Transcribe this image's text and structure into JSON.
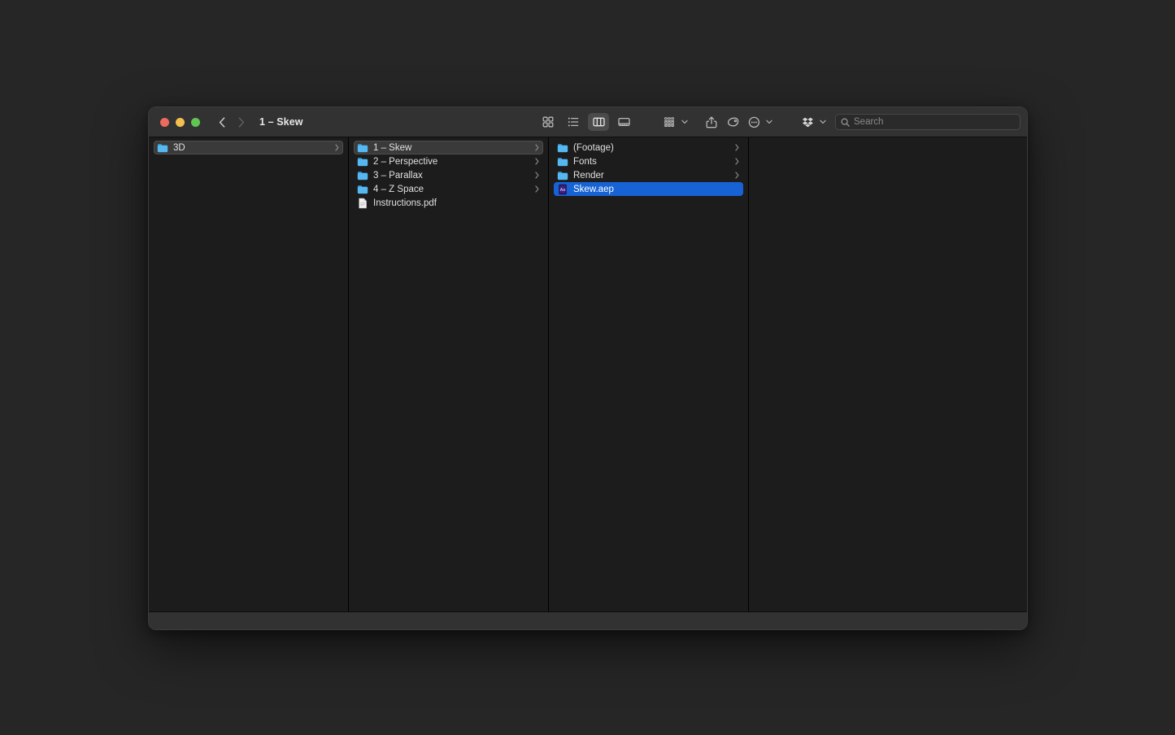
{
  "window": {
    "title": "1 – Skew",
    "traffic_lights": [
      {
        "name": "close",
        "color": "#ed6a5e"
      },
      {
        "name": "minimize",
        "color": "#f4bf4f"
      },
      {
        "name": "maximize",
        "color": "#61c554"
      }
    ]
  },
  "toolbar": {
    "back_icon": "chevron-left-icon",
    "forward_icon": "chevron-right-icon",
    "view_modes": [
      {
        "id": "icon",
        "icon": "grid-view-icon",
        "label": "Icon View",
        "active": false
      },
      {
        "id": "list",
        "icon": "list-view-icon",
        "label": "List View",
        "active": false
      },
      {
        "id": "column",
        "icon": "column-view-icon",
        "label": "Column View",
        "active": true
      },
      {
        "id": "gallery",
        "icon": "gallery-view-icon",
        "label": "Gallery View",
        "active": false
      }
    ],
    "group_by": {
      "icon": "group-by-icon",
      "label": "Group Items"
    },
    "share": {
      "icon": "share-icon",
      "label": "Share"
    },
    "tags": {
      "icon": "tag-icon",
      "label": "Edit Tags"
    },
    "action": {
      "icon": "action-menu-icon",
      "label": "Action Menu"
    },
    "dropbox": {
      "icon": "dropbox-icon",
      "label": "Dropbox"
    }
  },
  "search": {
    "icon": "search-icon",
    "placeholder": "Search",
    "value": ""
  },
  "columns": [
    {
      "id": "column-1",
      "items": [
        {
          "name": "3D",
          "kind": "folder",
          "icon": "folder-icon",
          "selected": "inactive",
          "disclosure": true
        }
      ]
    },
    {
      "id": "column-2",
      "items": [
        {
          "name": "1 – Skew",
          "kind": "folder",
          "icon": "folder-icon",
          "selected": "inactive",
          "disclosure": true
        },
        {
          "name": "2 – Perspective",
          "kind": "folder",
          "icon": "folder-icon",
          "selected": "none",
          "disclosure": true
        },
        {
          "name": "3 – Parallax",
          "kind": "folder",
          "icon": "folder-icon",
          "selected": "none",
          "disclosure": true
        },
        {
          "name": "4 – Z Space",
          "kind": "folder",
          "icon": "folder-icon",
          "selected": "none",
          "disclosure": true
        },
        {
          "name": "Instructions.pdf",
          "kind": "file",
          "icon": "pdf-document-icon",
          "selected": "none",
          "disclosure": false
        }
      ]
    },
    {
      "id": "column-3",
      "items": [
        {
          "name": "(Footage)",
          "kind": "folder",
          "icon": "folder-icon",
          "selected": "none",
          "disclosure": true
        },
        {
          "name": "Fonts",
          "kind": "folder",
          "icon": "folder-icon",
          "selected": "none",
          "disclosure": true
        },
        {
          "name": "Render",
          "kind": "folder",
          "icon": "folder-icon",
          "selected": "none",
          "disclosure": true
        },
        {
          "name": "Skew.aep",
          "kind": "file",
          "icon": "after-effects-project-icon",
          "selected": "active",
          "disclosure": false
        }
      ]
    },
    {
      "id": "column-4",
      "items": []
    }
  ],
  "colors": {
    "selection_blue": "#1763d6",
    "selection_gray": "#3a3a3a",
    "folder_blue": "#55b8f0",
    "toolbar_bg": "#323232",
    "content_bg": "#1c1c1c",
    "desktop_bg": "#262626"
  }
}
